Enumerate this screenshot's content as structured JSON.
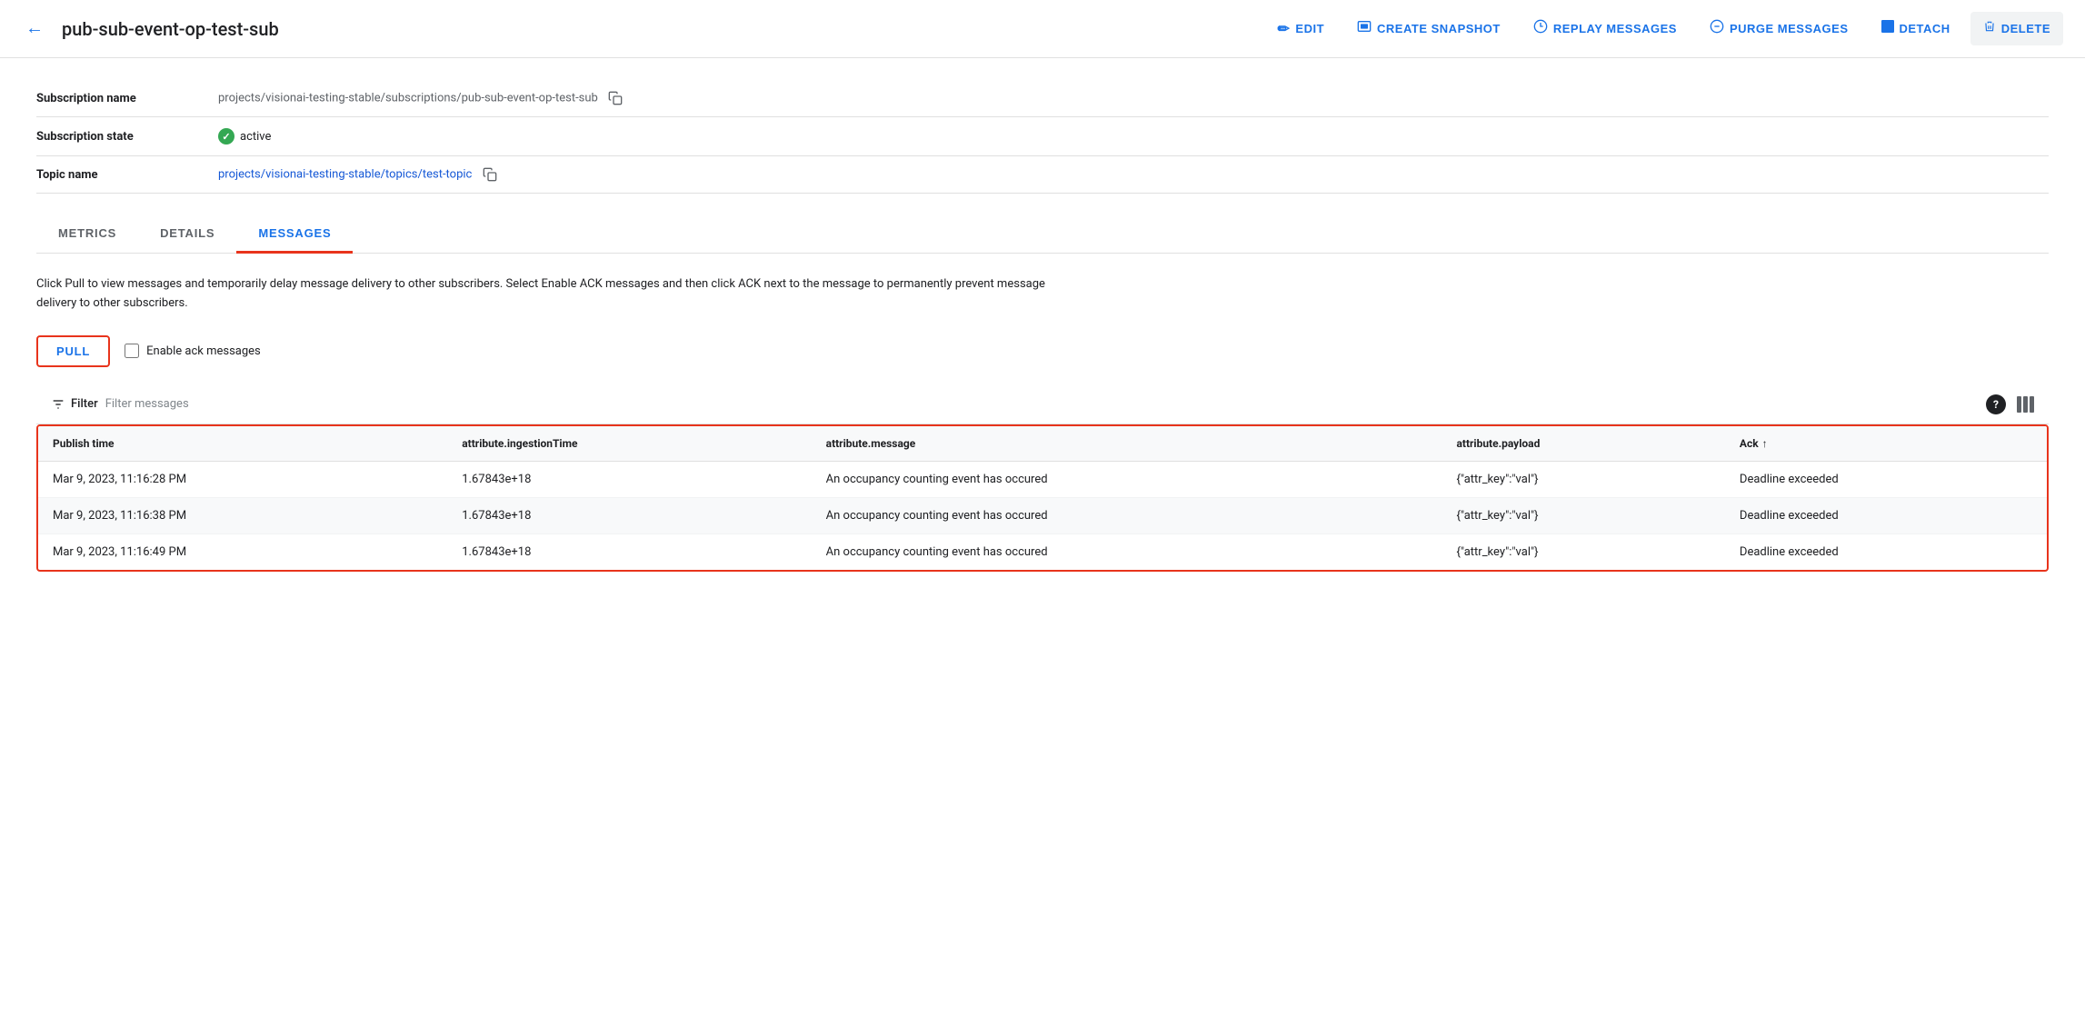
{
  "header": {
    "back_label": "←",
    "title": "pub-sub-event-op-test-sub",
    "actions": [
      {
        "id": "edit",
        "label": "EDIT",
        "icon": "✏️"
      },
      {
        "id": "create-snapshot",
        "label": "CREATE SNAPSHOT",
        "icon": "📷"
      },
      {
        "id": "replay-messages",
        "label": "REPLAY MESSAGES",
        "icon": "⏱"
      },
      {
        "id": "purge-messages",
        "label": "PURGE MESSAGES",
        "icon": "⊖"
      },
      {
        "id": "detach",
        "label": "DETACH",
        "icon": "⬛"
      },
      {
        "id": "delete",
        "label": "DELETE",
        "icon": "🗑"
      }
    ]
  },
  "info": {
    "rows": [
      {
        "label": "Subscription name",
        "value": "projects/visionai-testing-stable/subscriptions/pub-sub-event-op-test-sub",
        "has_copy": true,
        "is_link": false,
        "is_status": false
      },
      {
        "label": "Subscription state",
        "value": "active",
        "has_copy": false,
        "is_link": false,
        "is_status": true
      },
      {
        "label": "Topic name",
        "value": "projects/visionai-testing-stable/topics/test-topic",
        "has_copy": true,
        "is_link": true,
        "is_status": false
      }
    ]
  },
  "tabs": [
    {
      "id": "metrics",
      "label": "METRICS",
      "active": false
    },
    {
      "id": "details",
      "label": "DETAILS",
      "active": false
    },
    {
      "id": "messages",
      "label": "MESSAGES",
      "active": true
    }
  ],
  "messages_tab": {
    "description": "Click Pull to view messages and temporarily delay message delivery to other subscribers. Select Enable ACK messages and then click ACK next to the message to permanently prevent message delivery to other subscribers.",
    "pull_label": "PULL",
    "enable_ack_label": "Enable ack messages",
    "filter": {
      "label": "Filter",
      "placeholder": "Filter messages"
    },
    "table": {
      "columns": [
        {
          "id": "publish_time",
          "label": "Publish time",
          "sortable": false
        },
        {
          "id": "ingestion_time",
          "label": "attribute.ingestionTime",
          "sortable": false
        },
        {
          "id": "message",
          "label": "attribute.message",
          "sortable": false
        },
        {
          "id": "payload",
          "label": "attribute.payload",
          "sortable": false
        },
        {
          "id": "ack",
          "label": "Ack",
          "sortable": true
        }
      ],
      "rows": [
        {
          "publish_time": "Mar 9, 2023, 11:16:28 PM",
          "ingestion_time": "1.67843e+18",
          "message": "An occupancy counting event has occured",
          "payload": "{\"attr_key\":\"val\"}",
          "ack": "Deadline exceeded"
        },
        {
          "publish_time": "Mar 9, 2023, 11:16:38 PM",
          "ingestion_time": "1.67843e+18",
          "message": "An occupancy counting event has occured",
          "payload": "{\"attr_key\":\"val\"}",
          "ack": "Deadline exceeded"
        },
        {
          "publish_time": "Mar 9, 2023, 11:16:49 PM",
          "ingestion_time": "1.67843e+18",
          "message": "An occupancy counting event has occured",
          "payload": "{\"attr_key\":\"val\"}",
          "ack": "Deadline exceeded"
        }
      ]
    }
  },
  "colors": {
    "primary_blue": "#1a73e8",
    "danger_red": "#e8341c",
    "active_green": "#34a853"
  }
}
